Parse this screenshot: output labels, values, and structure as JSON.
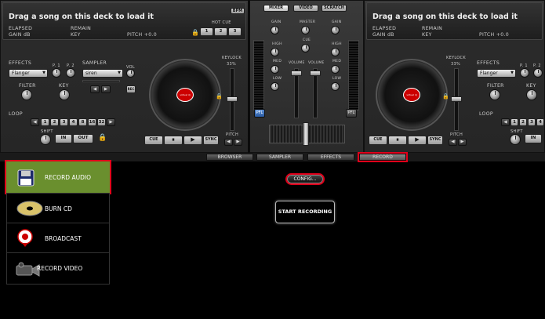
{
  "decks": {
    "left": {
      "song_title": "Drag a song on this deck to load it",
      "elapsed": "ELAPSED",
      "remain": "REMAIN",
      "gain": "GAIN dB",
      "key": "KEY",
      "pitch": "PITCH +0.0",
      "bpm": "BPM",
      "hot_cue": "HOT CUE",
      "hot_cues": [
        "1",
        "2",
        "3"
      ],
      "effects_label": "EFFECTS",
      "effect_value": "Flanger",
      "p1": "P. 1",
      "p2": "P. 2",
      "sampler_label": "SAMPLER",
      "sampler_value": "siren",
      "vol": "VOL",
      "rec": "REC",
      "filter": "FILTER",
      "key_knob": "KEY",
      "loop": "LOOP",
      "loop_sizes": [
        "1",
        "2",
        "3",
        "4",
        "8",
        "16",
        "32"
      ],
      "shift": "SHIFT",
      "in": "IN",
      "out": "OUT",
      "keylock": "KEYLOCK",
      "keylock_pct": "33%",
      "cue": "CUE",
      "sync": "SYNC",
      "pitch_lbl": "PITCH",
      "platter_label": "virtual dj"
    },
    "right": {
      "song_title": "Drag a song on this deck to load it",
      "elapsed": "ELAPSED",
      "remain": "REMAIN",
      "gain": "GAIN dB",
      "key": "KEY",
      "pitch": "PITCH +0.0",
      "effects_label": "EFFECTS",
      "effect_value": "Flanger",
      "p1": "P. 1",
      "p2": "P. 2",
      "filter": "FILTER",
      "key_knob": "KEY",
      "loop": "LOOP",
      "loop_sizes": [
        "1",
        "2",
        "3",
        "4",
        "8"
      ],
      "shift": "SHIFT",
      "in": "IN",
      "out": "OUT",
      "keylock": "KEYLOCK",
      "keylock_pct": "33%",
      "cue": "CUE",
      "sync": "SYNC",
      "pitch_lbl": "PITCH",
      "platter_label": "virtual dj"
    }
  },
  "mixer": {
    "tabs": [
      "MIXER",
      "VIDEO",
      "SCRATCH"
    ],
    "gain": "GAIN",
    "master": "MASTER",
    "cue": "CUE",
    "high": "HIGH",
    "med": "MED",
    "low": "LOW",
    "volume": "VOLUME",
    "pfl": "PFL"
  },
  "bottom_tabs": [
    "BROWSER",
    "SAMPLER",
    "EFFECTS",
    "RECORD"
  ],
  "sidebar": {
    "items": [
      {
        "label": "RECORD AUDIO",
        "icon": "floppy-disk-icon",
        "active": true
      },
      {
        "label": "BURN CD",
        "icon": "cd-icon",
        "active": false
      },
      {
        "label": "BROADCAST",
        "icon": "broadcast-icon",
        "active": false
      },
      {
        "label": "RECORD VIDEO",
        "icon": "video-camera-icon",
        "active": false
      }
    ]
  },
  "record": {
    "config_label": "CONFIG...",
    "start_label": "START RECORDING"
  },
  "colors": {
    "highlight": "#e0001a",
    "active_item": "#6a8f2e"
  }
}
